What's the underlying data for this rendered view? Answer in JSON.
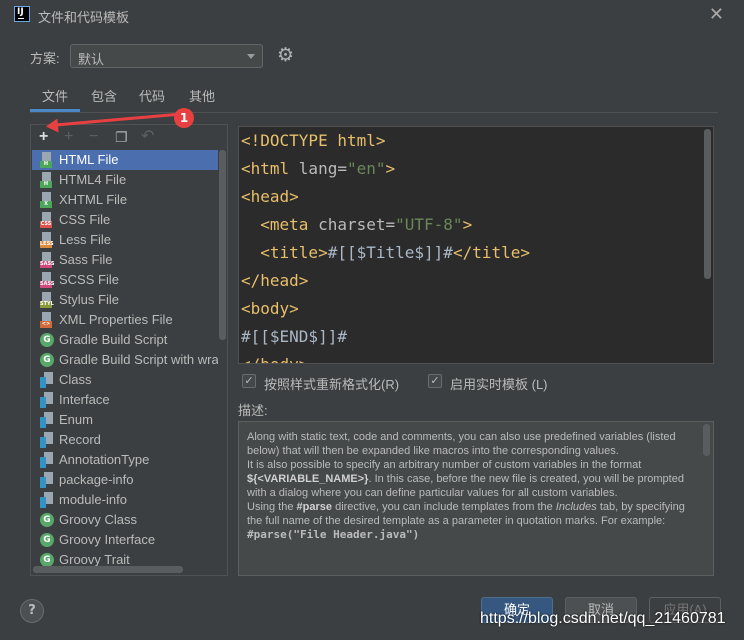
{
  "window": {
    "title": "文件和代码模板"
  },
  "scheme": {
    "label": "方案:",
    "value": "默认"
  },
  "tabs": [
    {
      "label": "文件"
    },
    {
      "label": "包含"
    },
    {
      "label": "代码"
    },
    {
      "label": "其他"
    }
  ],
  "toolbar": {
    "add": "+",
    "copy": "+",
    "remove": "−",
    "duplicate": "❐",
    "reset": "↶"
  },
  "templates": [
    {
      "label": "HTML File",
      "icon": "html-file-icon",
      "badge": "H",
      "color": "#4da75b",
      "selected": true
    },
    {
      "label": "HTML4 File",
      "icon": "html-file-icon",
      "badge": "H",
      "color": "#4da75b"
    },
    {
      "label": "XHTML File",
      "icon": "xhtml-file-icon",
      "badge": "X",
      "color": "#4da75b"
    },
    {
      "label": "CSS File",
      "icon": "css-file-icon",
      "badge": "CSS",
      "color": "#d9534f"
    },
    {
      "label": "Less File",
      "icon": "less-file-icon",
      "badge": "LESS",
      "color": "#d98a3a"
    },
    {
      "label": "Sass File",
      "icon": "sass-file-icon",
      "badge": "SASS",
      "color": "#cf4a7a"
    },
    {
      "label": "SCSS File",
      "icon": "scss-file-icon",
      "badge": "SASS",
      "color": "#cf4a7a"
    },
    {
      "label": "Stylus File",
      "icon": "stylus-file-icon",
      "badge": "STYL",
      "color": "#8a9a3a"
    },
    {
      "label": "XML Properties File",
      "icon": "xml-file-icon",
      "badge": "<>",
      "color": "#d06a3a"
    },
    {
      "label": "Gradle Build Script",
      "icon": "gradle-icon",
      "badge": "G",
      "color": "#59a869",
      "circle": true
    },
    {
      "label": "Gradle Build Script with wrapper",
      "icon": "gradle-icon",
      "badge": "G",
      "color": "#59a869",
      "circle": true
    },
    {
      "label": "Class",
      "icon": "java-class-icon",
      "java": true
    },
    {
      "label": "Interface",
      "icon": "java-interface-icon",
      "java": true
    },
    {
      "label": "Enum",
      "icon": "java-enum-icon",
      "java": true
    },
    {
      "label": "Record",
      "icon": "java-record-icon",
      "java": true
    },
    {
      "label": "AnnotationType",
      "icon": "java-annotation-icon",
      "java": true
    },
    {
      "label": "package-info",
      "icon": "java-package-info-icon",
      "java": true
    },
    {
      "label": "module-info",
      "icon": "java-module-info-icon",
      "java": true
    },
    {
      "label": "Groovy Class",
      "icon": "groovy-icon",
      "badge": "G",
      "color": "#59a869",
      "circle": true
    },
    {
      "label": "Groovy Interface",
      "icon": "groovy-icon",
      "badge": "G",
      "color": "#59a869",
      "circle": true
    },
    {
      "label": "Groovy Trait",
      "icon": "groovy-icon",
      "badge": "G",
      "color": "#59a869",
      "circle": true
    }
  ],
  "code_lines": [
    [
      {
        "t": "<!DOCTYPE html>",
        "c": "tag"
      }
    ],
    [
      {
        "t": "<html ",
        "c": "tag"
      },
      {
        "t": "lang=",
        "c": "attr"
      },
      {
        "t": "\"en\"",
        "c": "str"
      },
      {
        "t": ">",
        "c": "tag"
      }
    ],
    [
      {
        "t": "<head>",
        "c": "tag"
      }
    ],
    [
      {
        "t": "  <meta ",
        "c": "tag"
      },
      {
        "t": "charset=",
        "c": "attr"
      },
      {
        "t": "\"UTF-8\"",
        "c": "str"
      },
      {
        "t": ">",
        "c": "tag"
      }
    ],
    [
      {
        "t": "  <title>",
        "c": "tag"
      },
      {
        "t": "#[[$Title$]]#",
        "c": "macro"
      },
      {
        "t": "</title>",
        "c": "tag"
      }
    ],
    [
      {
        "t": "</head>",
        "c": "tag"
      }
    ],
    [
      {
        "t": "<body>",
        "c": "tag"
      }
    ],
    [
      {
        "t": "#[[$END$]]#",
        "c": "macro"
      }
    ],
    [
      {
        "t": "</body>",
        "c": "tag"
      }
    ]
  ],
  "options": {
    "reformat_label": "按照样式重新格式化(R)",
    "reformat_checked": true,
    "live_template_label": "启用实时模板 (L)",
    "live_template_checked": true
  },
  "description": {
    "label": "描述:",
    "p1": "Along with static text, code and comments, you can also use predefined variables (listed below) that will then be expanded like macros into the corresponding values.",
    "p2a": "It is also possible to specify an arbitrary number of custom variables in the format ",
    "p2b": "${<VARIABLE_NAME>}",
    "p2c": ". In this case, before the new file is created, you will be prompted with a dialog where you can define particular values for all custom variables.",
    "p3a": "Using the ",
    "p3b": "#parse",
    "p3c": " directive, you can include templates from the ",
    "p3d": "Includes",
    "p3e": " tab, by specifying the full name of the desired template as a parameter in quotation marks. For example:",
    "p4": "#parse(\"File Header.java\")"
  },
  "buttons": {
    "help": "?",
    "ok": "确定",
    "cancel": "取消",
    "apply": "应用(A)"
  },
  "watermark": "https://blog.csdn.net/qq_21460781",
  "annotation": {
    "badge": "1",
    "color": "#e84040"
  }
}
